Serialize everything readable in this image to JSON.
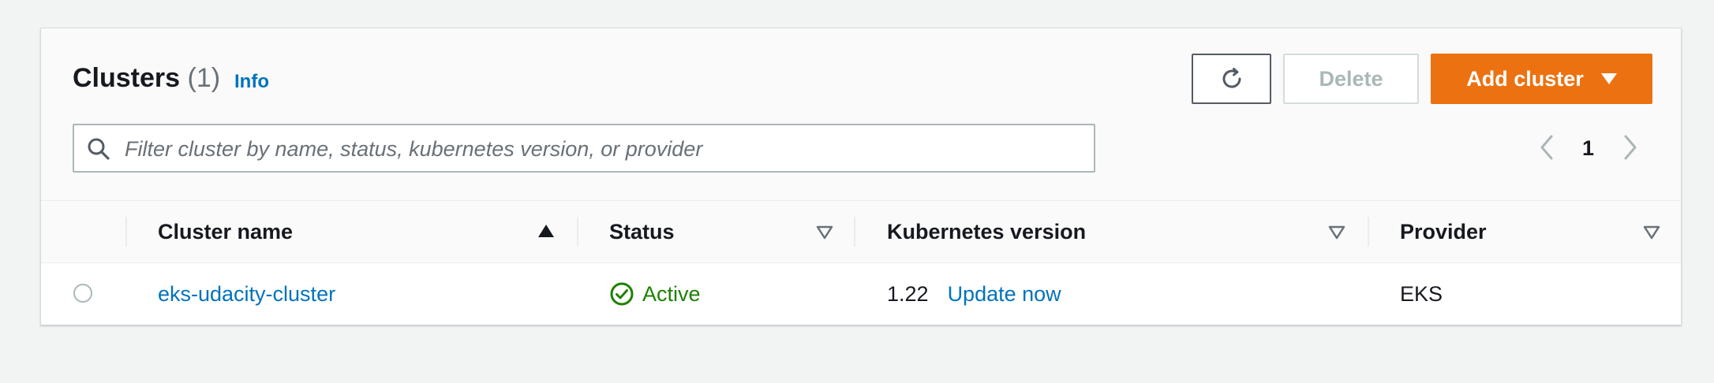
{
  "header": {
    "title": "Clusters",
    "count": "(1)",
    "info_label": "Info"
  },
  "actions": {
    "refresh_icon": "refresh-icon",
    "delete_label": "Delete",
    "add_cluster_label": "Add cluster"
  },
  "search": {
    "placeholder": "Filter cluster by name, status, kubernetes version, or provider",
    "value": ""
  },
  "pagination": {
    "current_page": "1"
  },
  "table": {
    "columns": [
      {
        "label": "Cluster name",
        "sort": "ascending"
      },
      {
        "label": "Status",
        "sort": "none"
      },
      {
        "label": "Kubernetes version",
        "sort": "none"
      },
      {
        "label": "Provider",
        "sort": "none"
      }
    ],
    "rows": [
      {
        "selected": false,
        "name": "eks-udacity-cluster",
        "status": "Active",
        "kubernetes_version": "1.22",
        "update_link": "Update now",
        "provider": "EKS"
      }
    ]
  },
  "colors": {
    "primary_button": "#ec7211",
    "link": "#0073bb",
    "status_success": "#1d8102"
  }
}
